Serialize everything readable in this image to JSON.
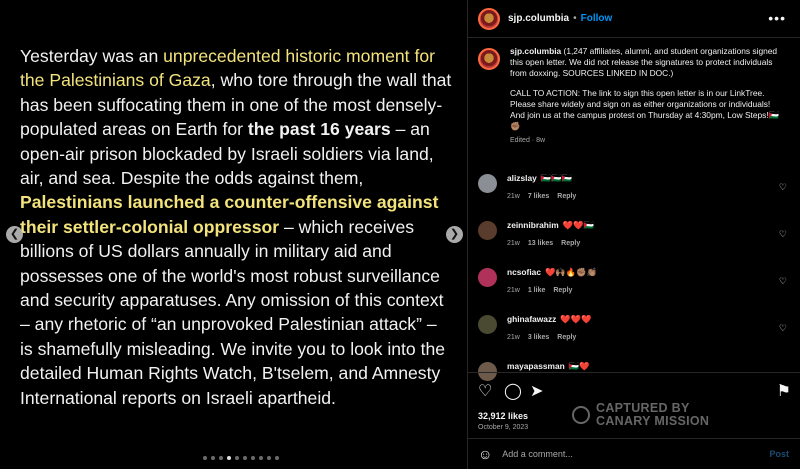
{
  "post": {
    "segments": [
      {
        "text": "Yesterday was an ",
        "style": "n"
      },
      {
        "text": "unprecedented historic moment for the Palestinians of Gaza",
        "style": "hl"
      },
      {
        "text": ", who tore through the wall that has been suffocating them in one of the most densely-populated areas on Earth for ",
        "style": "n"
      },
      {
        "text": "the past 16 years",
        "style": "b"
      },
      {
        "text": " – an open-air prison blockaded by Israeli soldiers via land, air, and sea. Despite the odds against them, ",
        "style": "n"
      },
      {
        "text": "Palestinians launched a counter-offensive against their settler-colonial oppressor",
        "style": "bh"
      },
      {
        "text": " – which receives billions of US dollars annually in military aid and possesses one of the world's most robust surveillance and security apparatuses. Any omission of this context – any rhetoric of “an unprovoked Palestinian attack” – is shamefully misleading. We invite you to look into the detailed Human Rights Watch, B'tselem, and Amnesty International reports on Israeli apartheid.",
        "style": "n"
      }
    ],
    "carousel_count": 10,
    "carousel_active": 3
  },
  "header": {
    "username": "sjp.columbia",
    "separator": "•",
    "follow_label": "Follow",
    "more_icon": "more-horizontal-icon"
  },
  "caption": {
    "username": "sjp.columbia",
    "para1": "(1,247 affiliates, alumni, and student organizations signed this open letter. We did not release the signatures to protect individuals from doxxing. SOURCES LINKED IN DOC.)",
    "para2": "CALL TO ACTION: The link to sign this open letter is in our LinkTree. Please share widely and sign on as either organizations or individuals! And join us at the campus protest on Thursday at 4:30pm, Low Steps!🇵🇸✊🏽",
    "meta": "Edited · 8w"
  },
  "comments": [
    {
      "username": "alizslay",
      "text": "🇵🇸🇵🇸🇵🇸",
      "time": "21w",
      "likes": "7 likes",
      "reply": "Reply",
      "avatar_color": "#8a8f95"
    },
    {
      "username": "zeinnibrahim",
      "text": "❤️❤️🇵🇸",
      "time": "21w",
      "likes": "13 likes",
      "reply": "Reply",
      "avatar_color": "#5a3c2c"
    },
    {
      "username": "ncsofiac",
      "text": "❤️🙌🏽🔥✊🏽👏🏽",
      "time": "21w",
      "likes": "1 like",
      "reply": "Reply",
      "avatar_color": "#b0325a"
    },
    {
      "username": "ghinafawazz",
      "text": "❤️❤️❤️",
      "time": "21w",
      "likes": "3 likes",
      "reply": "Reply",
      "avatar_color": "#4a4a32"
    },
    {
      "username": "mayapassman",
      "text": "🇵🇸❤️",
      "time": "",
      "likes": "",
      "reply": "",
      "avatar_color": "#6d5a4a"
    }
  ],
  "actions": {
    "like_icon": "heart-icon",
    "comment_icon": "comment-icon",
    "share_icon": "share-icon",
    "save_icon": "bookmark-icon",
    "likes": "32,912 likes",
    "date": "October 9, 2023"
  },
  "watermark": {
    "line1": "CAPTURED BY",
    "line2": "CANARY MISSION"
  },
  "add_comment": {
    "placeholder": "Add a comment...",
    "post_label": "Post",
    "emoji_icon": "smiley-icon"
  }
}
